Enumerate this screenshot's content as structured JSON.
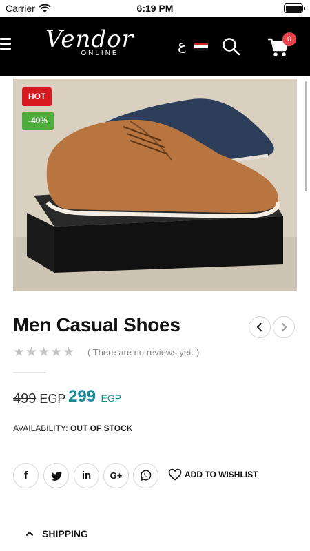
{
  "status_bar": {
    "carrier": "Carrier",
    "time": "6:19 PM"
  },
  "header": {
    "logo_main": "Vendor",
    "logo_sub": "ONLINE",
    "language": "ع",
    "cart_count": "0",
    "icons": [
      "menu-icon",
      "egypt-flag-icon",
      "search-icon",
      "cart-icon"
    ]
  },
  "product": {
    "badges": {
      "hot": "HOT",
      "discount": "-40%"
    },
    "title": "Men Casual Shoes",
    "rating": 0,
    "reviews_text": "( There are no reviews yet. )",
    "old_price": "499",
    "old_currency": "EGP",
    "new_price": "299",
    "new_currency": "EGP",
    "availability_label": "AVAILABILITY:",
    "availability_value": "OUT OF STOCK"
  },
  "actions": {
    "wishlist_label": "ADD TO WISHLIST"
  },
  "social": [
    {
      "icon": "facebook-icon",
      "glyph": "f"
    },
    {
      "icon": "twitter-icon",
      "glyph": ""
    },
    {
      "icon": "linkedin-icon",
      "glyph": "in"
    },
    {
      "icon": "google-plus-icon",
      "glyph": "G+"
    },
    {
      "icon": "whatsapp-icon",
      "glyph": ""
    }
  ],
  "accordion": {
    "shipping_label": "SHIPPING"
  },
  "colors": {
    "header_bg": "#000000",
    "accent": "#1a8a9a",
    "hot_badge": "#d71920",
    "sale_badge": "#4caf3b",
    "cart_badge": "#e8434a"
  }
}
